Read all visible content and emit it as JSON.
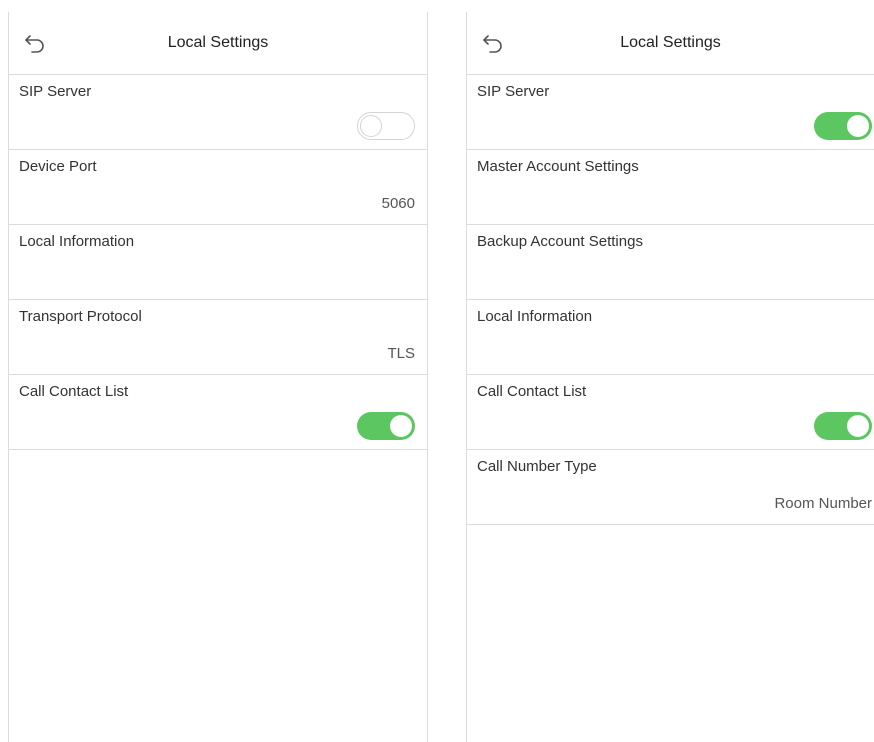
{
  "left_screen": {
    "title": "Local Settings",
    "rows": [
      {
        "label": "SIP Server",
        "toggle": "off"
      },
      {
        "label": "Device Port",
        "value": "5060"
      },
      {
        "label": "Local Information"
      },
      {
        "label": "Transport Protocol",
        "value": "TLS"
      },
      {
        "label": "Call Contact List",
        "toggle": "on"
      }
    ]
  },
  "right_screen": {
    "title": "Local Settings",
    "rows": [
      {
        "label": "SIP Server",
        "toggle": "on"
      },
      {
        "label": "Master Account Settings"
      },
      {
        "label": "Backup Account Settings"
      },
      {
        "label": "Local Information"
      },
      {
        "label": "Call Contact List",
        "toggle": "on"
      },
      {
        "label": "Call Number Type",
        "value": "Room Number"
      }
    ]
  },
  "colors": {
    "toggle_on": "#5cc760",
    "divider": "#dcdcdc"
  },
  "icons": {
    "back": "back-arrow-icon"
  }
}
